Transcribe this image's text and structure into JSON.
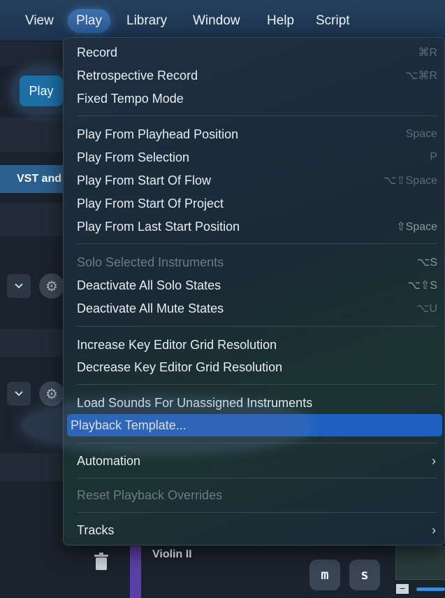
{
  "menubar": {
    "items": [
      "View",
      "Play",
      "Library",
      "Window",
      "Help",
      "Script"
    ],
    "active": "Play"
  },
  "background": {
    "play_button": "Play",
    "vst_button": "VST and",
    "track_name": "Violin II",
    "mute_button": "m",
    "solo_button": "s",
    "minus_button": "−"
  },
  "menu": {
    "record": {
      "label": "Record",
      "shortcut": "⌘R"
    },
    "retrospective_record": {
      "label": "Retrospective Record",
      "shortcut": "⌥⌘R"
    },
    "fixed_tempo": {
      "label": "Fixed Tempo Mode"
    },
    "play_from_playhead": {
      "label": "Play From Playhead Position",
      "shortcut": "Space"
    },
    "play_from_selection": {
      "label": "Play From Selection",
      "shortcut": "P"
    },
    "play_from_start_flow": {
      "label": "Play From Start Of Flow",
      "shortcut": "⌥⇧Space"
    },
    "play_from_start_project": {
      "label": "Play From Start Of Project"
    },
    "play_from_last_start": {
      "label": "Play From Last Start Position",
      "shortcut": "⇧Space"
    },
    "solo_selected": {
      "label": "Solo Selected Instruments",
      "shortcut": "⌥S"
    },
    "deactivate_solo": {
      "label": "Deactivate All Solo States",
      "shortcut": "⌥⇧S"
    },
    "deactivate_mute": {
      "label": "Deactivate All Mute States",
      "shortcut": "⌥U"
    },
    "increase_grid": {
      "label": "Increase Key Editor Grid Resolution"
    },
    "decrease_grid": {
      "label": "Decrease Key Editor Grid Resolution"
    },
    "load_sounds": {
      "label": "Load Sounds For Unassigned Instruments"
    },
    "playback_template": {
      "label": "Playback Template..."
    },
    "automation": {
      "label": "Automation",
      "arrow": "›"
    },
    "reset_overrides": {
      "label": "Reset Playback Overrides"
    },
    "tracks": {
      "label": "Tracks",
      "arrow": "›"
    }
  },
  "colors": {
    "highlight": "#1f5fbf",
    "menubar": "#1c3450",
    "violin_track": "#5b3fa6"
  }
}
